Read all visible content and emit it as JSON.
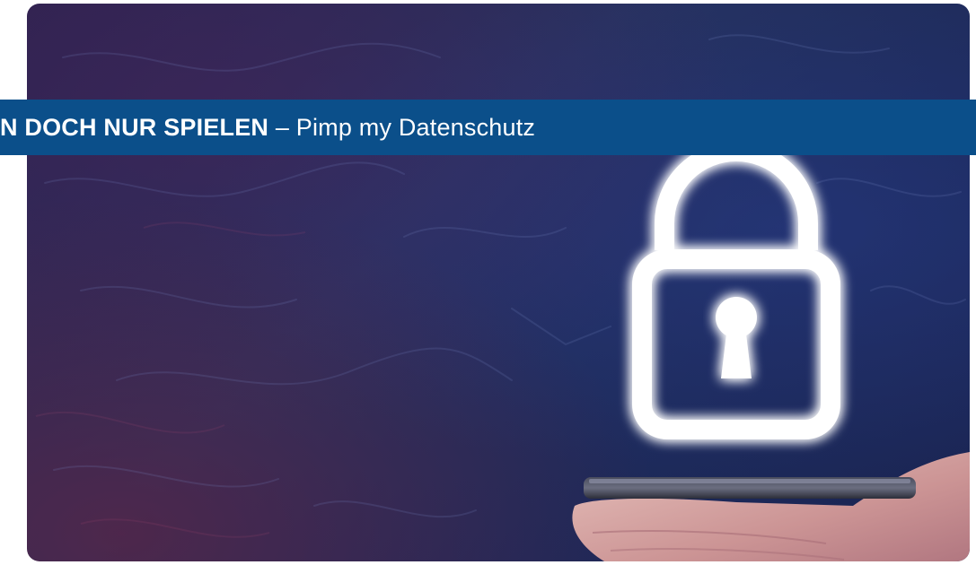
{
  "banner": {
    "title_bold": "N DOCH NUR SPIELEN",
    "title_rest": " – Pimp my Datenschutz"
  },
  "hero": {
    "image_subject": "lock-icon",
    "accent_color": "#0b4f8a",
    "background_color": "#1d2a5a"
  }
}
